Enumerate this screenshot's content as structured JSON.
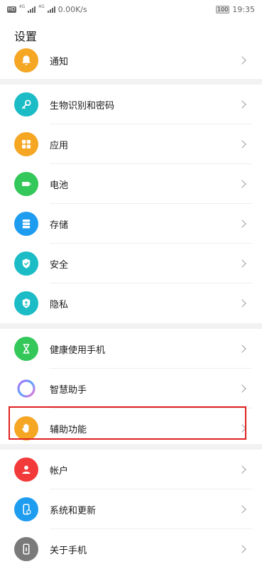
{
  "status": {
    "speed": "0.00K/s",
    "battery": "100",
    "time": "19:35"
  },
  "title": "设置",
  "groups": [
    {
      "items": [
        {
          "label": "通知",
          "color": "#f5a623",
          "icon": "bell-icon"
        }
      ]
    },
    {
      "items": [
        {
          "label": "生物识别和密码",
          "color": "#1bbcc6",
          "icon": "key-icon"
        },
        {
          "label": "应用",
          "color": "#f5a623",
          "icon": "apps-grid-icon"
        },
        {
          "label": "电池",
          "color": "#34c759",
          "icon": "battery-icon"
        },
        {
          "label": "存储",
          "color": "#1e9cf0",
          "icon": "storage-icon"
        },
        {
          "label": "安全",
          "color": "#1bbcc6",
          "icon": "shield-check-icon"
        },
        {
          "label": "隐私",
          "color": "#1bbcc6",
          "icon": "privacy-shield-icon"
        }
      ]
    },
    {
      "items": [
        {
          "label": "健康使用手机",
          "color": "#34c759",
          "icon": "hourglass-icon"
        },
        {
          "label": "智慧助手",
          "color": "#ffffff",
          "icon": "assistant-ring-icon"
        },
        {
          "label": "辅助功能",
          "color": "#f5a623",
          "icon": "hand-icon"
        }
      ]
    },
    {
      "items": [
        {
          "label": "帐户",
          "color": "#f23a3a",
          "icon": "user-icon"
        },
        {
          "label": "系统和更新",
          "color": "#1e9cf0",
          "icon": "phone-update-icon"
        },
        {
          "label": "关于手机",
          "color": "#7a7a7a",
          "icon": "phone-info-icon"
        }
      ]
    }
  ]
}
